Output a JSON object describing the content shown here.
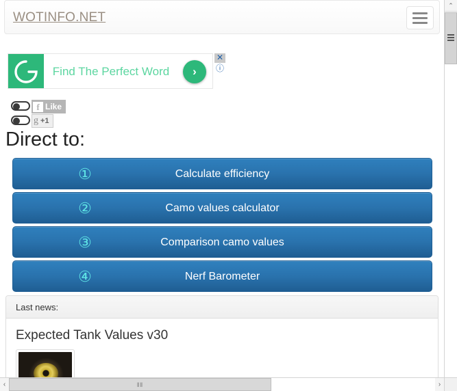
{
  "browser": {
    "vertical_scrollbar": {
      "up_arrow": "⌃",
      "down_arrow": "⌄",
      "thumb_grip": "grip"
    },
    "horizontal_scrollbar": {
      "left_arrow": "‹",
      "right_arrow": "›",
      "thumb_grip": "‖‖"
    }
  },
  "navbar": {
    "brand": "WOTINFO.NET",
    "toggle_label": "Toggle navigation"
  },
  "ad": {
    "logo_letter": "G",
    "headline": "Find The Perfect Word",
    "cta_glyph": "›",
    "close_glyph": "✕",
    "info_glyph": "ⓘ"
  },
  "social": {
    "facebook": {
      "glyph": "f",
      "label": "Like",
      "toggle_state": "off"
    },
    "google": {
      "glyph": "g",
      "label": "+1",
      "toggle_state": "off"
    }
  },
  "main": {
    "direct_heading": "Direct to:",
    "buttons": [
      {
        "number": "①",
        "label": "Calculate efficiency"
      },
      {
        "number": "②",
        "label": "Camo values calculator"
      },
      {
        "number": "③",
        "label": "Comparison camo values"
      },
      {
        "number": "④",
        "label": "Nerf Barometer"
      }
    ]
  },
  "news": {
    "header": "Last news:",
    "items": [
      {
        "title": "Expected Tank Values v30",
        "thumbnail_alt": "tank-sprocket-wheel"
      }
    ]
  },
  "colors": {
    "button_blue_top": "#2f80bd",
    "button_blue_bottom": "#1f5e93",
    "button_number_cyan": "#5fe6e6",
    "brand_text": "#9a8f83",
    "ad_green": "#2db87a",
    "ad_text_green": "#5cd6a0"
  }
}
